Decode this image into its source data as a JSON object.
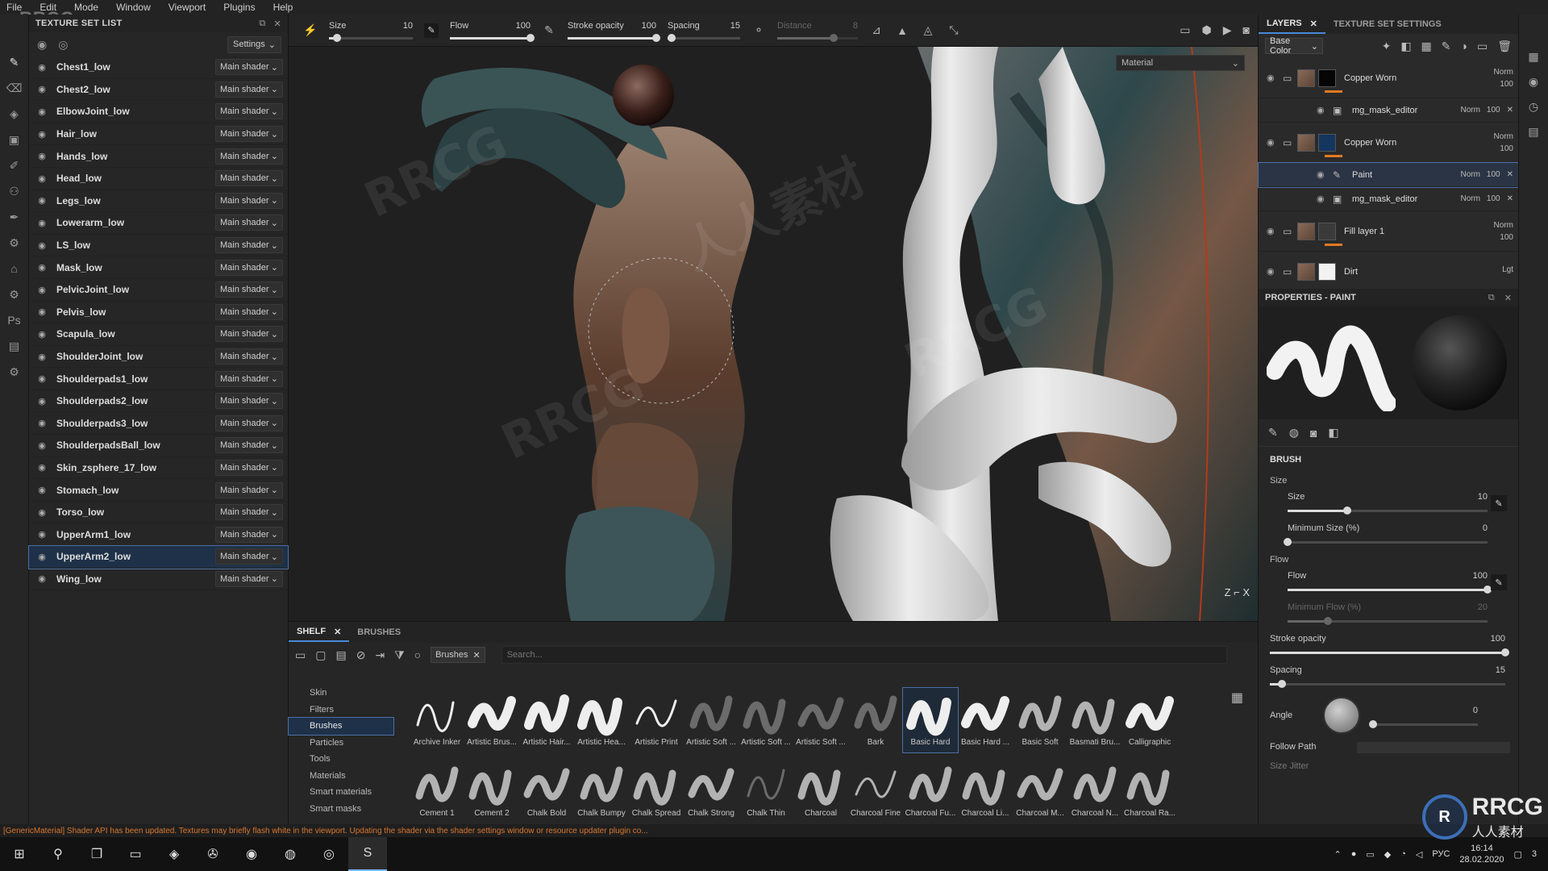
{
  "menu": [
    "File",
    "Edit",
    "Mode",
    "Window",
    "Viewport",
    "Plugins",
    "Help"
  ],
  "logo_top": "RRCG",
  "texture_set_list": {
    "title": "TEXTURE SET LIST",
    "settings_label": "Settings",
    "shader_label": "Main shader",
    "selected_index": 22,
    "items": [
      "Chest1_low",
      "Chest2_low",
      "ElbowJoint_low",
      "Hair_low",
      "Hands_low",
      "Head_low",
      "Legs_low",
      "Lowerarm_low",
      "LS_low",
      "Mask_low",
      "PelvicJoint_low",
      "Pelvis_low",
      "Scapula_low",
      "ShoulderJoint_low",
      "Shoulderpads1_low",
      "Shoulderpads2_low",
      "Shoulderpads3_low",
      "ShoulderpadsBall_low",
      "Skin_zsphere_17_low",
      "Stomach_low",
      "Torso_low",
      "UpperArm1_low",
      "UpperArm2_low",
      "Wing_low"
    ]
  },
  "toolbar": {
    "size": {
      "label": "Size",
      "value": "10",
      "fraction": 0.1
    },
    "flow": {
      "label": "Flow",
      "value": "100",
      "fraction": 1.0
    },
    "stroke_opacity": {
      "label": "Stroke opacity",
      "value": "100",
      "fraction": 1.0
    },
    "spacing": {
      "label": "Spacing",
      "value": "15",
      "fraction": 0.05
    },
    "distance": {
      "label": "Distance",
      "value": "8",
      "fraction": 0.7
    }
  },
  "viewport": {
    "material_select": "Material",
    "axis": "Z ⌐ X"
  },
  "layers": {
    "tab_layers": "LAYERS",
    "tab_tss": "TEXTURE SET SETTINGS",
    "channel": "Base Color",
    "rows": [
      {
        "kind": "big",
        "name": "Copper Worn",
        "thumb": "black",
        "blend": "Norm",
        "opacity": "100",
        "selected": false
      },
      {
        "kind": "sub",
        "name": "mg_mask_editor",
        "blend": "Norm",
        "opacity": "100",
        "selected": false
      },
      {
        "kind": "big",
        "name": "Copper Worn",
        "thumb": "blue",
        "blend": "Norm",
        "opacity": "100",
        "selected": false
      },
      {
        "kind": "sub",
        "name": "Paint",
        "blend": "Norm",
        "opacity": "100",
        "selected": true
      },
      {
        "kind": "sub",
        "name": "mg_mask_editor",
        "blend": "Norm",
        "opacity": "100",
        "selected": false
      },
      {
        "kind": "big",
        "name": "Fill layer 1",
        "thumb": "grey",
        "blend": "Norm",
        "opacity": "100",
        "selected": false
      },
      {
        "kind": "big",
        "name": "Dirt",
        "thumb": "white",
        "blend": "Lgt",
        "opacity": "",
        "selected": false
      }
    ]
  },
  "properties": {
    "title": "PROPERTIES - PAINT",
    "brush_section": "BRUSH",
    "size_group": "Size",
    "size": {
      "label": "Size",
      "value": "10",
      "fraction": 0.3
    },
    "min_size": {
      "label": "Minimum Size (%)",
      "value": "0",
      "fraction": 0.0
    },
    "flow_group": "Flow",
    "flow": {
      "label": "Flow",
      "value": "100",
      "fraction": 1.0
    },
    "min_flow": {
      "label": "Minimum Flow (%)",
      "value": "20",
      "fraction": 0.2
    },
    "stroke_opacity": {
      "label": "Stroke opacity",
      "value": "100",
      "fraction": 1.0
    },
    "spacing": {
      "label": "Spacing",
      "value": "15",
      "fraction": 0.05
    },
    "angle": {
      "label": "Angle",
      "value": "0",
      "fraction": 0.0
    },
    "follow_path": "Follow Path",
    "size_jitter": "Size Jitter"
  },
  "shelf": {
    "tab_shelf": "SHELF",
    "tab_brushes": "BRUSHES",
    "filter_chip": "Brushes",
    "search_placeholder": "Search...",
    "categories": [
      "Skin",
      "Filters",
      "Brushes",
      "Particles",
      "Tools",
      "Materials",
      "Smart materials",
      "Smart masks"
    ],
    "active_category": 2,
    "active_brush": 9,
    "brushes": [
      "Archive Inker",
      "Artistic Brus...",
      "Artistic Hair...",
      "Artistic Hea...",
      "Artistic Print",
      "Artistic Soft ...",
      "Artistic Soft ...",
      "Artistic Soft ...",
      "Bark",
      "Basic Hard",
      "Basic Hard ...",
      "Basic Soft",
      "Basmati Bru...",
      "Calligraphic",
      "Cement 1",
      "Cement 2",
      "Chalk Bold",
      "Chalk Bumpy",
      "Chalk Spread",
      "Chalk Strong",
      "Chalk Thin",
      "Charcoal",
      "Charcoal Fine",
      "Charcoal Fu...",
      "Charcoal Li...",
      "Charcoal M...",
      "Charcoal N...",
      "Charcoal Ra..."
    ]
  },
  "status": "[GenericMaterial] Shader API has been updated. Textures may briefly flash white in the viewport. Updating the shader via the shader settings window or resource updater plugin co...",
  "taskbar": {
    "lang": "РУС",
    "time": "16:14",
    "date": "28.02.2020",
    "notifications": "3"
  },
  "watermark_text": "RRCG",
  "watermark_cn": "人人素材",
  "corner_logo": {
    "big": "RRCG",
    "small": "人人素材"
  },
  "colors": {
    "accent": "#4a8ad8",
    "selection": "#1f3148",
    "status_orange": "#d9772e",
    "mask_orange": "#e07a22"
  }
}
